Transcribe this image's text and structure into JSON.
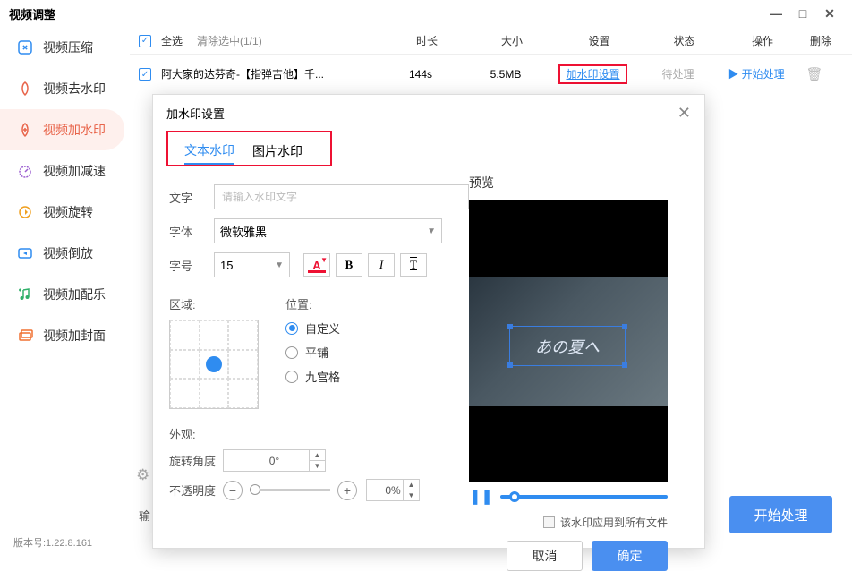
{
  "window": {
    "title": "视频调整"
  },
  "sidebar": {
    "items": [
      {
        "label": "视频压缩",
        "icon": "compress-icon",
        "color": "#2f8cf0"
      },
      {
        "label": "视频去水印",
        "icon": "remove-watermark-icon",
        "color": "#e8644a"
      },
      {
        "label": "视频加水印",
        "icon": "add-watermark-icon",
        "color": "#e8644a",
        "active": true
      },
      {
        "label": "视频加减速",
        "icon": "speed-icon",
        "color": "#9b5fd0"
      },
      {
        "label": "视频旋转",
        "icon": "rotate-icon",
        "color": "#f0a020"
      },
      {
        "label": "视频倒放",
        "icon": "reverse-icon",
        "color": "#2f8cf0"
      },
      {
        "label": "视频加配乐",
        "icon": "music-icon",
        "color": "#30b06a"
      },
      {
        "label": "视频加封面",
        "icon": "cover-icon",
        "color": "#f07030"
      }
    ]
  },
  "table": {
    "select_all": "全选",
    "clear": "清除选中(1/1)",
    "headers": {
      "duration": "时长",
      "size": "大小",
      "settings": "设置",
      "status": "状态",
      "action": "操作",
      "delete": "删除"
    },
    "rows": [
      {
        "name": "阿大家的达芬奇-【指弹吉他】千...",
        "duration": "144s",
        "size": "5.5MB",
        "settings": "加水印设置",
        "status": "待处理",
        "action": "开始处理"
      }
    ]
  },
  "output_label": "输",
  "start_button": "开始处理",
  "version_label": "版本号:1.22.8.161",
  "modal": {
    "title": "加水印设置",
    "tabs": {
      "text": "文本水印",
      "image": "图片水印"
    },
    "fields": {
      "text_label": "文字",
      "text_placeholder": "请输入水印文字",
      "font_label": "字体",
      "font_value": "微软雅黑",
      "size_label": "字号",
      "size_value": "15",
      "bold": "B",
      "italic": "I",
      "underline": "T"
    },
    "area_label": "区域:",
    "position": {
      "label": "位置:",
      "options": [
        "自定义",
        "平铺",
        "九宫格"
      ],
      "selected": "自定义"
    },
    "preview_label": "预览",
    "watermark_text": "あの夏へ",
    "apply_all": "该水印应用到所有文件",
    "appearance_label": "外观:",
    "rotation": {
      "label": "旋转角度",
      "value": "0°"
    },
    "opacity": {
      "label": "不透明度",
      "value": "0%"
    },
    "cancel": "取消",
    "ok": "确定"
  }
}
